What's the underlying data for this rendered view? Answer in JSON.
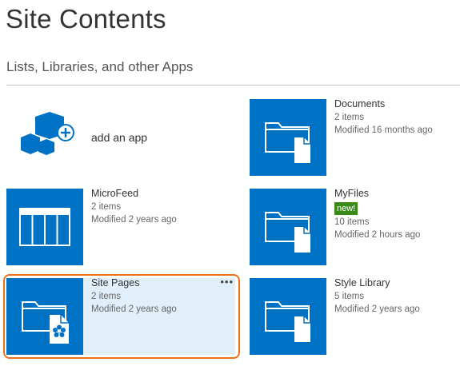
{
  "page": {
    "title": "Site Contents",
    "section_title": "Lists, Libraries, and other Apps"
  },
  "add_app": {
    "label": "add an app"
  },
  "tiles": [
    {
      "name": "Documents",
      "count": "2 items",
      "modified": "Modified 16 months ago",
      "icon": "folder-document-icon"
    },
    {
      "name": "MicroFeed",
      "count": "2 items",
      "modified": "Modified 2 years ago",
      "icon": "list-table-icon"
    },
    {
      "name": "MyFiles",
      "badge": "new!",
      "count": "10 items",
      "modified": "Modified 2 hours ago",
      "icon": "folder-document-icon"
    },
    {
      "name": "Site Pages",
      "count": "2 items",
      "modified": "Modified 2 years ago",
      "icon": "folder-pages-icon",
      "menu": "•••"
    },
    {
      "name": "Style Library",
      "count": "5 items",
      "modified": "Modified 2 years ago",
      "icon": "folder-document-icon"
    }
  ],
  "colors": {
    "tile_blue": "#0072c6",
    "selected_bg": "#e1effb",
    "focus_orange": "#e8711e",
    "badge_green": "#3a8a16"
  }
}
